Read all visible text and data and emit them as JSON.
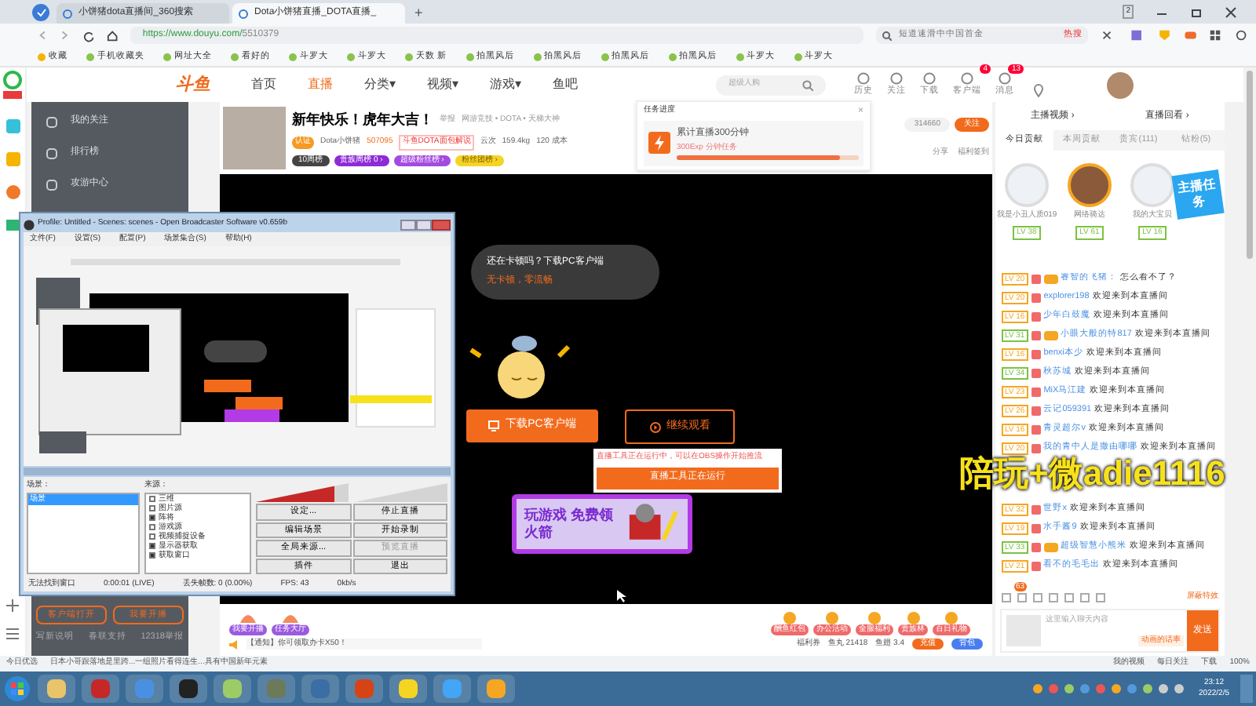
{
  "browser": {
    "tabs": [
      {
        "title": "小饼猪dota直播间_360搜索",
        "selected": false
      },
      {
        "title": "Dota小饼猪直播_DOTA直播_",
        "selected": true
      }
    ],
    "new_tab": "+",
    "tab_count": "2",
    "url_host": "https://www.douyu.com/",
    "url_path": "5510379",
    "search_placeholder": "短道速滑中中国首金",
    "search_hot": "热搜"
  },
  "bookmarks": [
    "收藏",
    "手机收藏夹",
    "网址大全",
    "看好的",
    "斗罗大",
    "斗罗大",
    "天数 新",
    "拍黑风后",
    "拍黑风后",
    "拍黑风后",
    "拍黑风后",
    "斗罗大",
    "斗罗大"
  ],
  "site_nav": {
    "logo": "斗鱼",
    "items": [
      {
        "label": "首页",
        "selected": false
      },
      {
        "label": "直播",
        "selected": true
      },
      {
        "label": "分类▾",
        "selected": false
      },
      {
        "label": "视频▾",
        "selected": false
      },
      {
        "label": "游戏▾",
        "selected": false
      },
      {
        "label": "鱼吧",
        "selected": false
      }
    ],
    "search_placeholder": "超级人购",
    "icons": [
      {
        "label": "历史"
      },
      {
        "label": "关注"
      },
      {
        "label": "下载"
      },
      {
        "label": "客户端",
        "badge": "4"
      },
      {
        "label": "消息",
        "badge": "13"
      }
    ]
  },
  "sidebar": {
    "items": [
      "我的关注",
      "排行榜",
      "攻游中心"
    ],
    "bottom_buttons": [
      "客户端打开",
      "我要开播"
    ],
    "bottom_links": [
      "写新说明",
      "春联支持",
      "12318举报"
    ]
  },
  "room": {
    "title": "新年快乐！虎年大吉！",
    "report": "举报",
    "category": "网游竞技 • DOTA • 天梯大神",
    "verified": "认证",
    "streamer": "Dota小饼猪",
    "heat": "507095",
    "tag": "斗鱼DOTA面包解说",
    "stat_1": "云次",
    "stat_2": "159.4kg",
    "stat_3": "120 成本",
    "badges": [
      "10周榜",
      "贵族周榜 0 ›",
      "超级粉丝榜 ›",
      "粉丝团榜 ›"
    ],
    "followers": "314660",
    "follow": "关注",
    "share": "分享",
    "checkin": "福利签到"
  },
  "task_popup": {
    "title": "任务进度",
    "close": "×",
    "task": "累计直播300分钟",
    "reward": "300Exp 分钟任务",
    "level": 0.9
  },
  "video": {
    "bubble_line_1": "还在卡顿吗？下载PC客户端",
    "bubble_line_2": "无卡顿，零流畅",
    "download": "下载PC客户端",
    "continue": "继续观看",
    "tool_hint": "直播工具正在运行中，可以在OBS操作开始推流",
    "tool_running": "直播工具正在运行",
    "banner": "玩游戏 免费领火箭",
    "overlay": "陪玩+微adie1116"
  },
  "obs": {
    "title": "Profile: Untitled - Scenes: scenes - Open Broadcaster Software v0.659b",
    "menu": [
      "文件(F)",
      "设置(S)",
      "配置(P)",
      "场景集合(S)",
      "帮助(H)"
    ],
    "scenes_label": "场景：",
    "scenes": [
      {
        "label": "场景",
        "selected": true
      }
    ],
    "sources_label": "来源：",
    "sources": [
      {
        "label": "三维",
        "checked": false
      },
      {
        "label": "图片源",
        "checked": false
      },
      {
        "label": "阵将",
        "checked": true
      },
      {
        "label": "游戏源",
        "checked": false
      },
      {
        "label": "视频捕捉设备",
        "checked": false
      },
      {
        "label": "显示器获取",
        "checked": true
      },
      {
        "label": "获取窗口",
        "checked": true
      }
    ],
    "meters": [
      {
        "level": 0.85
      },
      {
        "level": 0.0
      }
    ],
    "buttons": [
      {
        "label": "设定...",
        "disabled": false
      },
      {
        "label": "停止直播",
        "disabled": false
      },
      {
        "label": "编辑场景",
        "disabled": false
      },
      {
        "label": "开始录制",
        "disabled": false
      },
      {
        "label": "全局来源...",
        "disabled": false
      },
      {
        "label": "预览直播",
        "disabled": true
      },
      {
        "label": "插件",
        "disabled": false
      },
      {
        "label": "退出",
        "disabled": false
      }
    ],
    "status": [
      "无法找到窗口",
      "0:00:01 (LIVE)",
      "丢失帧数: 0 (0.00%)",
      "FPS: 43",
      "0kb/s"
    ]
  },
  "chat": {
    "links": [
      "主播视频 ›",
      "直播回看 ›"
    ],
    "tabs": [
      {
        "label": "今日贡献",
        "selected": true
      },
      {
        "label": "本周贡献",
        "selected": false
      },
      {
        "label": "贵宾(111)",
        "selected": false
      },
      {
        "label": "钻粉(5)",
        "selected": false
      }
    ],
    "top": [
      {
        "name": "我是小丑人质019",
        "level": "LV 38"
      },
      {
        "name": "网络骑达",
        "level": "LV 61"
      },
      {
        "name": "我的大宝贝",
        "level": "LV 16"
      }
    ],
    "task_banner": "主播任务",
    "messages": [
      {
        "level": "LV 20",
        "color": "#f5a623",
        "noble": true,
        "name": "睿智的飞猪：",
        "text": "怎么看不了？"
      },
      {
        "level": "LV 20",
        "color": "#f5a623",
        "noble": false,
        "name": "explorer198",
        "text": "欢迎来到本直播间"
      },
      {
        "level": "LV 16",
        "color": "#f5a623",
        "noble": false,
        "name": "少年白鼓魔",
        "text": "欢迎来到本直播间"
      },
      {
        "level": "LV 31",
        "color": "#7cc242",
        "noble": true,
        "name": "小眼大般的特817",
        "text": "欢迎来到本直播间"
      },
      {
        "level": "LV 16",
        "color": "#f5a623",
        "noble": false,
        "name": "benxi本少",
        "text": "欢迎来到本直播间"
      },
      {
        "level": "LV 34",
        "color": "#7cc242",
        "noble": false,
        "name": "秋苏城",
        "text": "欢迎来到本直播间"
      },
      {
        "level": "LV 23",
        "color": "#f5a623",
        "noble": false,
        "name": "MiX马江建",
        "text": "欢迎来到本直播间"
      },
      {
        "level": "LV 26",
        "color": "#f5a623",
        "noble": false,
        "name": "云记059391",
        "text": "欢迎来到本直播间"
      },
      {
        "level": "LV 16",
        "color": "#f5a623",
        "noble": false,
        "name": "青灵超尔v",
        "text": "欢迎来到本直播间"
      },
      {
        "level": "LV 20",
        "color": "#f5a623",
        "noble": false,
        "name": "我的青中人是撒由哪哪",
        "text": "欢迎来到本直播间"
      },
      {
        "level": "LV 32",
        "color": "#f5a623",
        "noble": false,
        "name": "世野x",
        "text": "欢迎来到本直播间"
      },
      {
        "level": "LV 19",
        "color": "#f5a623",
        "noble": false,
        "name": "水手酱9",
        "text": "欢迎来到本直播间"
      },
      {
        "level": "LV 33",
        "color": "#7cc242",
        "noble": true,
        "name": "超级智慧小熊米",
        "text": "欢迎来到本直播间"
      },
      {
        "level": "LV 21",
        "color": "#f5a623",
        "noble": false,
        "name": "看不的毛毛出",
        "text": "欢迎来到本直播间"
      }
    ],
    "toolbar_badge": "63",
    "block_effects": "屏蔽特效",
    "input_placeholder": "这里输入聊天内容",
    "send": "发送",
    "hint": "动画的话率"
  },
  "gift_bar": {
    "left": [
      "我要开播",
      "任务大厅"
    ],
    "gifts": [
      "酬鱼红包",
      "办公活动",
      "全服福利",
      "贵族林",
      "百日礼物"
    ],
    "notice": "【通知】你可领取办卡X50！",
    "coupon": "福利券",
    "fish_balls": "鱼丸 21418",
    "fins": "鱼翅 3.4",
    "recharge": "充值",
    "backpack": "背包"
  },
  "status_bar": {
    "left": "今日优选",
    "news": "日本小哥跟落地是里跨...一组照片看得连生...具有中国新年元素",
    "items": [
      "我的视频",
      "每日关注",
      "下载",
      "100%"
    ]
  },
  "taskbar": {
    "time": "23:12",
    "date": "2022/2/5"
  }
}
